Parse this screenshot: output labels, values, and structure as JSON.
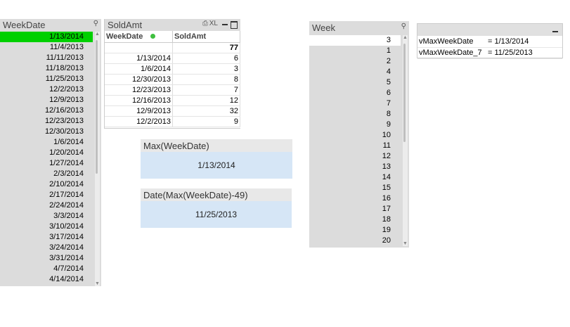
{
  "weekdate_listbox": {
    "title": "WeekDate",
    "search_icon": "magnifier-icon",
    "items": [
      "1/13/2014",
      "11/4/2013",
      "11/11/2013",
      "11/18/2013",
      "11/25/2013",
      "12/2/2013",
      "12/9/2013",
      "12/16/2013",
      "12/23/2013",
      "12/30/2013",
      "1/6/2014",
      "1/20/2014",
      "1/27/2014",
      "2/3/2014",
      "2/10/2014",
      "2/17/2014",
      "2/24/2014",
      "3/3/2014",
      "3/10/2014",
      "3/17/2014",
      "3/24/2014",
      "3/31/2014",
      "4/7/2014",
      "4/14/2014"
    ],
    "selected": "1/13/2014",
    "selected_color": "#00d000"
  },
  "soldamt_table": {
    "title": "SoldAmt",
    "xl_label": "XL",
    "columns": [
      "WeekDate",
      "SoldAmt"
    ],
    "total": "77",
    "rows": [
      [
        "1/13/2014",
        "6"
      ],
      [
        "1/6/2014",
        "3"
      ],
      [
        "12/30/2013",
        "8"
      ],
      [
        "12/23/2013",
        "7"
      ],
      [
        "12/16/2013",
        "12"
      ],
      [
        "12/9/2013",
        "32"
      ],
      [
        "12/2/2013",
        "9"
      ]
    ]
  },
  "max_weekdate": {
    "title": "Max(WeekDate)",
    "value": "1/13/2014"
  },
  "date_max_minus_49": {
    "title": "Date(Max(WeekDate)-49)",
    "value": "11/25/2013"
  },
  "week_listbox": {
    "title": "Week",
    "items": [
      "3",
      "1",
      "2",
      "4",
      "5",
      "6",
      "7",
      "8",
      "9",
      "10",
      "11",
      "12",
      "13",
      "14",
      "15",
      "16",
      "17",
      "18",
      "19",
      "20"
    ]
  },
  "variables_box": {
    "rows": [
      {
        "name": "vMaxWeekDate",
        "value": "= 1/13/2014"
      },
      {
        "name": "vMaxWeekDate_7",
        "value": "= 11/25/2013"
      }
    ]
  },
  "colors": {
    "caption_bg": "#dcdcdc",
    "textbox_bg": "#d6e6f6",
    "selected": "#00d000"
  }
}
